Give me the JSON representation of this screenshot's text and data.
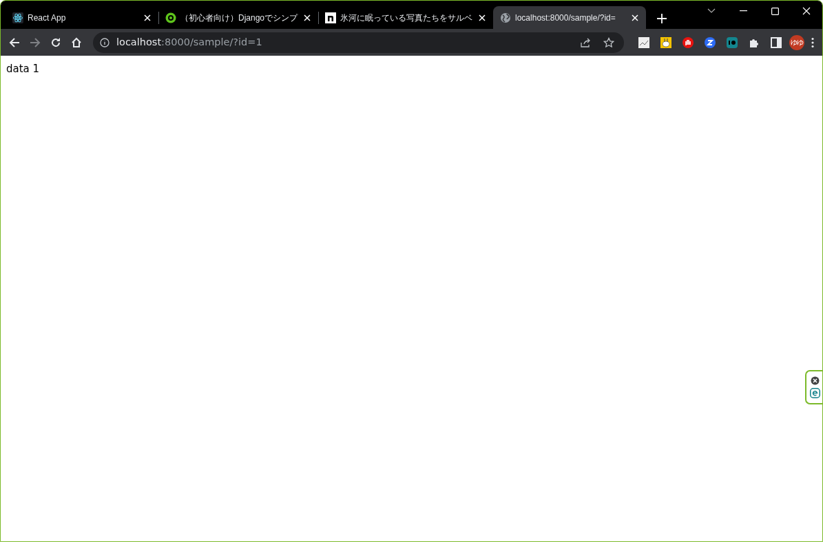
{
  "tabs": [
    {
      "title": "React App",
      "kind": "react",
      "selected": false
    },
    {
      "title": "（初心者向け）Djangoでシンプ",
      "kind": "green",
      "selected": false
    },
    {
      "title": "氷河に眠っている写真たちをサルベ",
      "kind": "n",
      "selected": false
    },
    {
      "title": "localhost:8000/sample/?id=",
      "kind": "globe",
      "selected": true
    }
  ],
  "address": {
    "host": "localhost",
    "path": ":8000/sample/?id=1"
  },
  "profile": {
    "initials": "ゆゆ"
  },
  "page": {
    "text": "data 1"
  }
}
